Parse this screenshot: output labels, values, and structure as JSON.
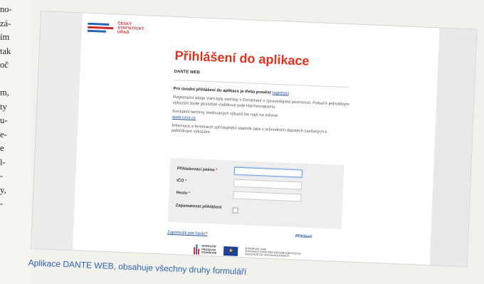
{
  "article": {
    "lines": [
      "no-",
      "zá-",
      "ím",
      "tak",
      "oč",
      "",
      "m,",
      "ty",
      "u-",
      "e-",
      "e",
      "l-",
      "-",
      "y,",
      "-"
    ]
  },
  "app": {
    "brand": {
      "line1": "ČESKÝ",
      "line2": "STATISTICKÝ",
      "line3": "ÚŘAD"
    },
    "title": "Přihlášení do aplikace",
    "subtitle": "DANTE WEB",
    "info": {
      "lead_bold": "Pro úvodní přihlášení do aplikace je třeba provést",
      "lead_link": "registraci",
      "para1": "Registrační údaje Vám byly zaslány v Oznámení o zpravodajské povinnosti. Pokud k jednotlivým výkazům bude příslušné vodítkové pole Harmonogramu.",
      "para2": "Kontaktní termíny sledovaných výkazů lze najít na adrese",
      "link2": "www.czso.cz",
      "para3": "Informace o termínech zpřístupnění statistik také v průvodních dopisech zasílaných k jednotlivým výkazům."
    },
    "form": {
      "username_label": "Přihlašovací jméno",
      "ico_label": "IČO",
      "password_label": "Heslo",
      "remember_label": "Zapamatovat přihlášení",
      "required_mark": "*",
      "username_value": "",
      "ico_value": "",
      "password_value": ""
    },
    "forgot_link": "Zapomněli jste heslo?",
    "login_button": "Přihlásit",
    "footer": {
      "op_line1": "OPERAČNÍ",
      "op_line2": "PROGRAM",
      "op_line3": "PODNIKÁNÍ",
      "eu_line1": "EVROPSKÁ UNIE",
      "eu_line2": "EVROPSKÝ FOND PRO REGIONÁLNÍ ROZVOJ",
      "eu_line3": "INVESTICE DO VAŠÍ BUDOUCNOSTI"
    }
  },
  "caption": "Aplikace DANTE WEB, obsahuje všechny druhy formuláří"
}
